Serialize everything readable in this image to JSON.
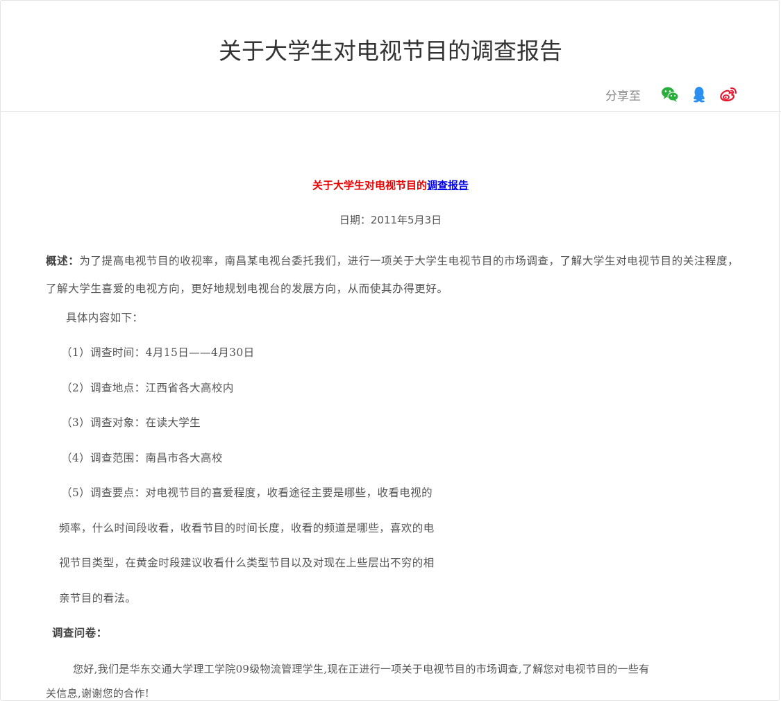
{
  "header": {
    "title": "关于大学生对电视节目的调查报告",
    "share_label": "分享至",
    "share_icons": [
      "wechat-icon",
      "qq-icon",
      "weibo-icon"
    ],
    "colors": {
      "wechat": "#2aae3e",
      "qq": "#2b8ff0",
      "weibo": "#e6162d"
    }
  },
  "article": {
    "title_red": "关于大学生对电视节目的",
    "title_link": "调查报告",
    "date": "日期：2011年5月3日",
    "summary_lead": "概述：",
    "summary_text": "为了提高电视节目的收视率，南昌某电视台委托我们，进行一项关于大学生电视节目的市场调查，了解大学生对电视节目的关注程度，了解大学生喜爱的电视方向，更好地规划电视台的发展方向，从而使其办得更好。",
    "content_intro": "具体内容如下：",
    "items": [
      "（1）调查时间：4月15日——4月30日",
      "（2）调查地点：江西省各大高校内",
      "（3）调查对象：在读大学生",
      "（4）调查范围：南昌市各大高校",
      "（5）调查要点：对电视节目的喜爱程度，收看途径主要是哪些，收看电视的"
    ],
    "item5_cont": [
      "频率，什么时间段收看，收看节目的时间长度，收看的频道是哪些，喜欢的电",
      "视节目类型，在黄金时段建议收看什么类型节目以及对现在上些层出不穷的相",
      "亲节目的看法。"
    ],
    "questionnaire_title": "调查问卷：",
    "questionnaire_text_1": "您好,我们是华东交通大学理工学院09级物流管理学生,现在正进行一项关于电视节目的市场调查,了解您对电视节目的一些有",
    "questionnaire_text_2": "关信息,谢谢您的合作!"
  }
}
